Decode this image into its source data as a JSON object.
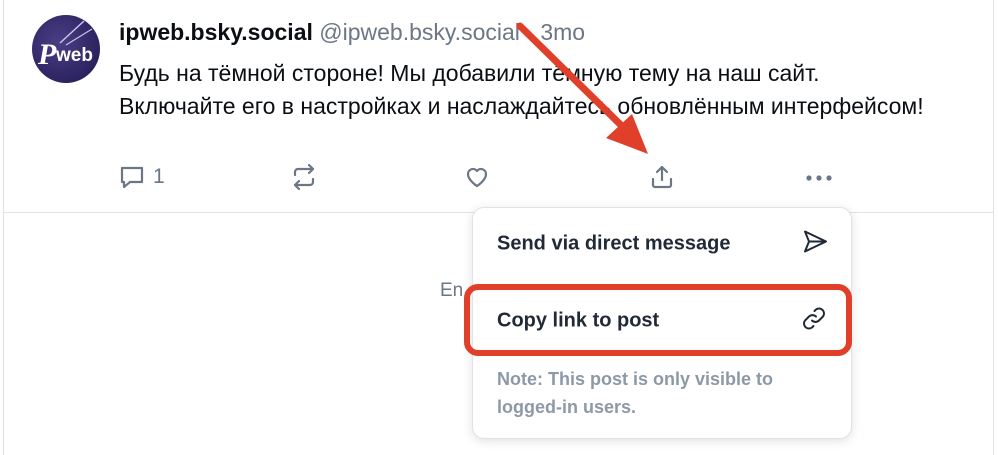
{
  "post": {
    "author": "ipweb.bsky.social",
    "handle": "@ipweb.bsky.social",
    "separator": "·",
    "time": "3mo",
    "text": "Будь на тёмной стороне! Мы добавили тёмную тему на наш сайт. Включайте его в настройках и наслаждайтесь обновлённым интерфейсом!",
    "reply_count": "1",
    "avatar_text": "IPweb"
  },
  "icons": {
    "reply": "reply-icon",
    "repost": "repost-icon",
    "like": "heart-icon",
    "share": "share-icon",
    "more": "more-dots-icon",
    "send": "paper-plane-icon",
    "link": "link-icon"
  },
  "feed": {
    "ended_text": "En"
  },
  "menu": {
    "send_label": "Send via direct message",
    "copy_label": "Copy link to post",
    "note": "Note: This post is only visible to logged-in users."
  },
  "colors": {
    "annotation": "#e0402a",
    "muted": "#6b7785",
    "note": "#8d99a7",
    "avatar": "#2c2360"
  }
}
